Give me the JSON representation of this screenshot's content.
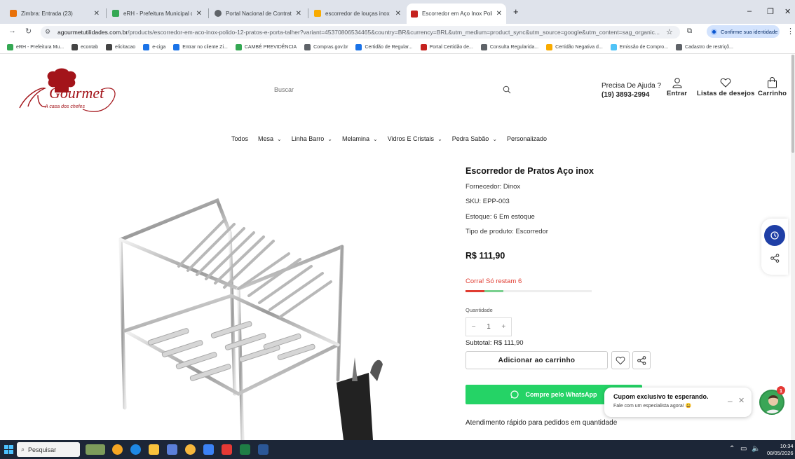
{
  "browser": {
    "tabs": [
      {
        "title": "Zimbra: Entrada (23)",
        "color": "#e8710a",
        "active": false
      },
      {
        "title": "eRH - Prefeitura Municipal de C",
        "color": "#34a853",
        "active": false
      },
      {
        "title": "Portal Nacional de Contratação",
        "color": "#5f6368",
        "active": false
      },
      {
        "title": "escorredor de louças inox - Go",
        "color": "#f9ab00",
        "active": false
      },
      {
        "title": "Escorredor em Aço Inox Polido",
        "color": "#c5221f",
        "active": true
      }
    ],
    "new_tab": "+",
    "window_controls": {
      "minimize": "–",
      "restore": "❐",
      "close": "✕"
    },
    "url_host": "agourmetutilidades.com.br",
    "url_path": "/products/escorredor-em-aco-inox-polido-12-pratos-e-porta-talher?variant=45370806534465&country=BR&currency=BRL&utm_medium=product_sync&utm_source=google&utm_content=sag_organic...",
    "identity_label": "Confirme sua identidade",
    "bookmarks": [
      {
        "label": "eRH - Prefeitura Mu...",
        "color": "#34a853"
      },
      {
        "label": "econtab",
        "color": "#444"
      },
      {
        "label": "elicitacao",
        "color": "#444"
      },
      {
        "label": "e-ciga",
        "color": "#1a73e8"
      },
      {
        "label": "Entrar no cliente Zi...",
        "color": "#1a73e8"
      },
      {
        "label": "CAMBÉ PREVIDÊNCIA",
        "color": "#34a853"
      },
      {
        "label": "Compras.gov.br",
        "color": "#5f6368"
      },
      {
        "label": "Certidão de Regular...",
        "color": "#1a73e8"
      },
      {
        "label": "Portal Certidão de...",
        "color": "#c5221f"
      },
      {
        "label": "Consulta Regularida...",
        "color": "#5f6368"
      },
      {
        "label": "Certidão Negativa d...",
        "color": "#f9ab00"
      },
      {
        "label": "Emissão de Compro...",
        "color": "#4fc3f7"
      },
      {
        "label": "Cadastro de restriçõ...",
        "color": "#5f6368"
      }
    ]
  },
  "site": {
    "logo_text": "A Gourmet",
    "logo_sub": "A casa dos chefes",
    "search_placeholder": "Buscar",
    "help_label": "Precisa De Ajuda ?",
    "help_phone": "(19) 3893-2994",
    "login_label": "Entrar",
    "wishlist_label": "Listas de desejos",
    "cart_label": "Carrinho",
    "nav": [
      {
        "label": "Todos",
        "dropdown": false
      },
      {
        "label": "Mesa",
        "dropdown": true
      },
      {
        "label": "Linha Barro",
        "dropdown": true
      },
      {
        "label": "Melamina",
        "dropdown": true
      },
      {
        "label": "Vidros E Cristais",
        "dropdown": true
      },
      {
        "label": "Pedra Sabão",
        "dropdown": true
      },
      {
        "label": "Personalizado",
        "dropdown": false
      }
    ]
  },
  "product": {
    "title": "Escorredor de Pratos Aço inox",
    "vendor": "Fornecedor: Dinox",
    "sku": "SKU: EPP-003",
    "stock": "Estoque: 6 Em estoque",
    "type": "Tipo de produto: Escorredor",
    "price": "R$ 111,90",
    "hurry": "Corra! Só restam 6",
    "stock_bar_fraction": 0.3,
    "quantity_label": "Quantidade",
    "quantity_minus": "−",
    "quantity_value": "1",
    "quantity_plus": "+",
    "subtotal": "Subtotal: R$ 111,90",
    "add_to_cart": "Adicionar ao carrinho",
    "whatsapp_label": "Compre pelo WhatsApp",
    "bulk_note": "Atendimento rápido para pedidos em quantidade"
  },
  "coupon": {
    "title": "Cupom exclusivo te esperando.",
    "subtitle": "Fale com um especialista agora! 😀",
    "minimize": "–",
    "close": "✕",
    "badge_count": "1"
  },
  "taskbar": {
    "search_label": "Pesquisar",
    "time": "10:34",
    "date": "08/05/2026"
  },
  "colors": {
    "whatsapp": "#25d366",
    "hurry": "#e03c31",
    "accent_blue": "#1f3fa6",
    "logo_red": "#a3141a"
  }
}
